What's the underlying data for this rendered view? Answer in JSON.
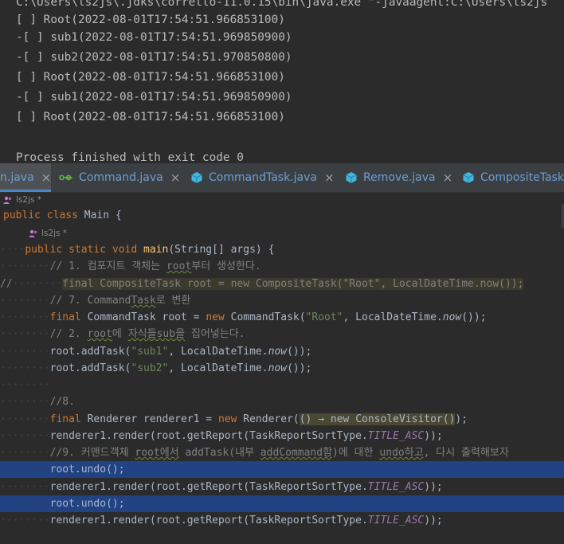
{
  "console": {
    "command_line": "C:\\Users\\ls2js\\.jdks\\corretto-11.0.15\\bin\\java.exe \"-javaagent:C:\\Users\\ls2js",
    "lines": [
      "[ ] Root(2022-08-01T17:54:51.966853100)",
      "-[ ] sub1(2022-08-01T17:54:51.969850900)",
      "-[ ] sub2(2022-08-01T17:54:51.970850800)",
      "[ ] Root(2022-08-01T17:54:51.966853100)",
      "-[ ] sub1(2022-08-01T17:54:51.969850900)",
      "[ ] Root(2022-08-01T17:54:51.966853100)"
    ],
    "exit_message": "Process finished with exit code 0"
  },
  "tabs": [
    {
      "label": "Main.java",
      "visible_label": "n.java",
      "icon": "class-icon",
      "active": true
    },
    {
      "label": "Command.java",
      "icon": "interface-icon",
      "active": false
    },
    {
      "label": "CommandTask.java",
      "icon": "class-icon",
      "active": false
    },
    {
      "label": "Remove.java",
      "icon": "class-icon",
      "active": false
    },
    {
      "label": "CompositeTask.java",
      "visible_label": "CompositeTask.j",
      "icon": "class-icon",
      "active": false
    }
  ],
  "tab_close_glyph": "×",
  "editor": {
    "author_class": "ls2js *",
    "author_method": "ls2js *",
    "code": {
      "l1_kw": "public class ",
      "l1_name": "Main {",
      "l2_kw": "public static void ",
      "l2_fn": "main",
      "l2_rest": "(String[] args) {",
      "c1a": "// 1. 컴포지트 객체는 ",
      "c1b": "root",
      "c1c": "부터 생성한다.",
      "l3_prefix": "//",
      "l3_code": "final CompositeTask root = new CompositeTask(\"Root\", LocalDateTime.now());",
      "c2a": "// 7. Command",
      "c2b": "Task",
      "c2c": "로 변환",
      "l4_final": "final ",
      "l4_a": "CommandTask root = ",
      "l4_new": "new ",
      "l4_b": "CommandTask(",
      "l4_str": "\"Root\"",
      "l4_c": ", LocalDateTime.",
      "l4_now": "now",
      "l4_d": "());",
      "c3a": "// 2. ",
      "c3b": "root",
      "c3c": "에 ",
      "c3d": "자식들sub을",
      "c3e": " 집어넣는다.",
      "l5_a": "root.addTask(",
      "l5_str": "\"sub1\"",
      "l5_b": ", LocalDateTime.",
      "l5_now": "now",
      "l5_c": "());",
      "l6_a": "root.addTask(",
      "l6_str": "\"sub2\"",
      "l6_b": ", LocalDateTime.",
      "l6_now": "now",
      "l6_c": "());",
      "c4": "//8.",
      "l7_final": "final ",
      "l7_a": "Renderer renderer1 = ",
      "l7_new": "new ",
      "l7_b": "Renderer(",
      "l7_lambda": "() → ",
      "l7_new2": "new ",
      "l7_c": "ConsoleVisitor()",
      "l7_d": ");",
      "l8_a": "renderer1.render(root.getReport(TaskReportSortType.",
      "l8_const": "TITLE_ASC",
      "l8_b": "));",
      "c5a": "//9. 커맨드객체 ",
      "c5b": "root에서",
      "c5c": " addTask(내부 ",
      "c5d": "addCommand함",
      "c5e": ")에 대한 ",
      "c5f": "undo하고",
      "c5g": ", 다시 출력해보자",
      "l9": "root.undo();",
      "l10_a": "renderer1.render(root.getReport(TaskReportSortType.",
      "l10_const": "TITLE_ASC",
      "l10_b": "));",
      "l11": "root.undo();",
      "l12_a": "renderer1.render(root.getReport(TaskReportSortType.",
      "l12_const": "TITLE_ASC",
      "l12_b": "));"
    }
  },
  "colors": {
    "background": "#2b2b2b",
    "tabbar": "#3c3f41",
    "selection": "#214283",
    "keyword": "#cc7832",
    "string": "#6a8759",
    "comment": "#808080",
    "method": "#ffc66d",
    "constant": "#9876aa",
    "tab_label": "#6a9fd5"
  }
}
